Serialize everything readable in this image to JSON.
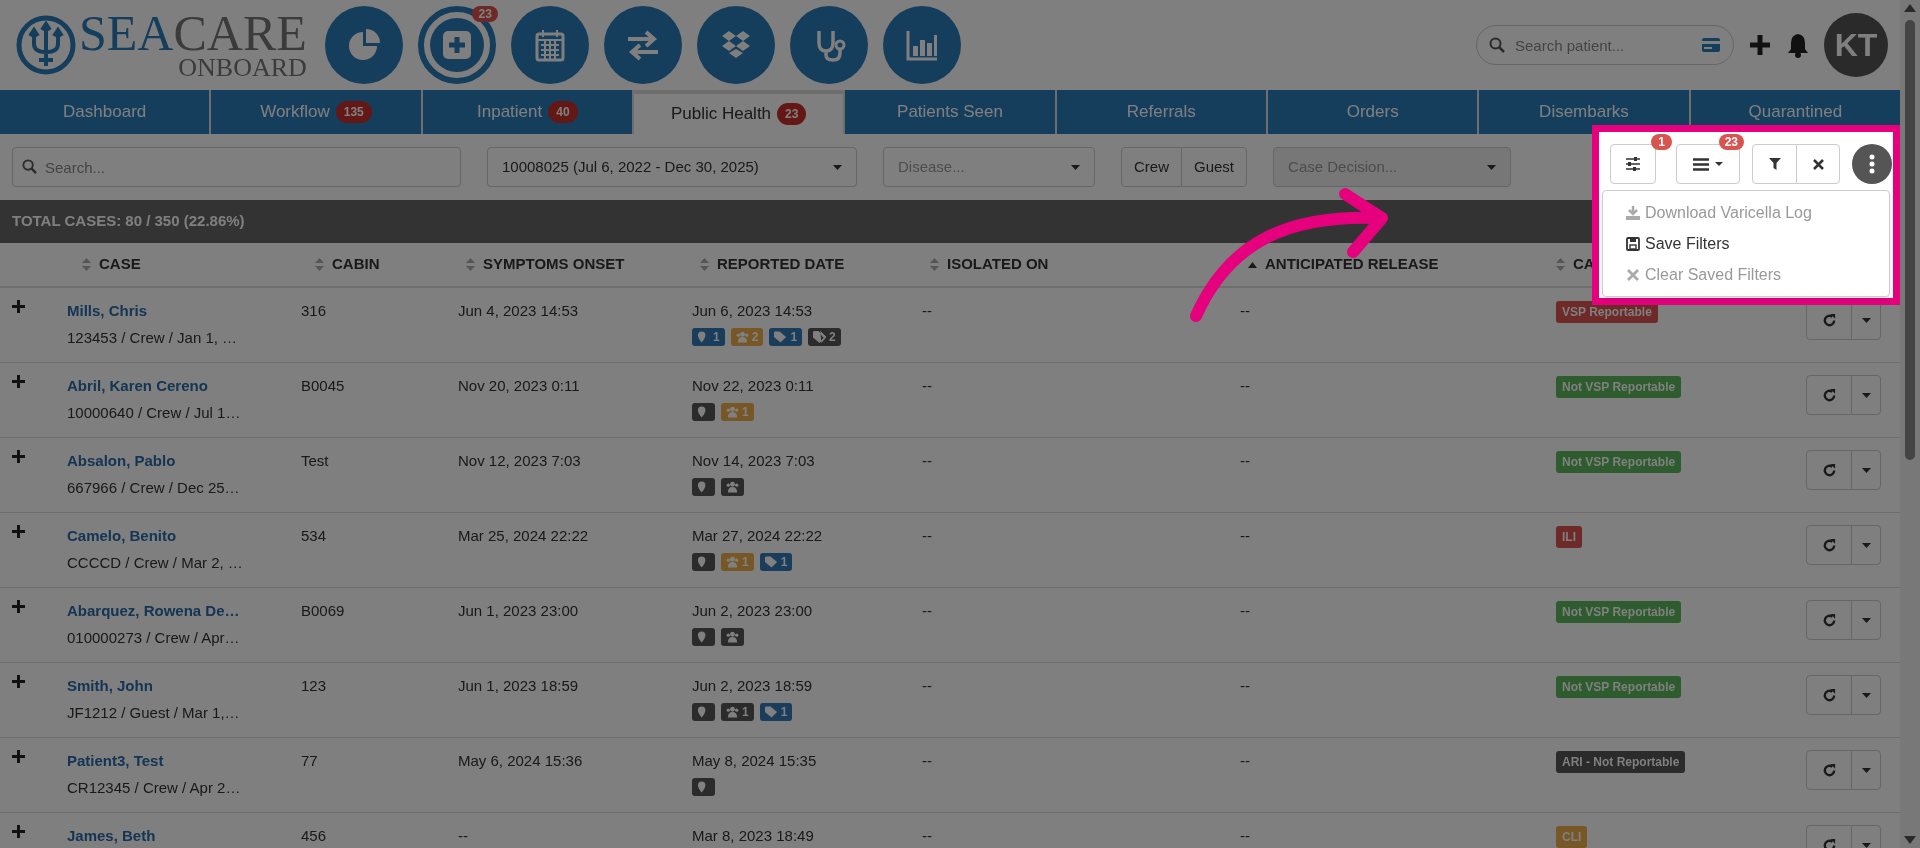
{
  "logo": {
    "brand_primary": "SEA",
    "brand_secondary": "CARE",
    "tagline": "ONBOARD"
  },
  "app_icons": [
    {
      "kind": "pie",
      "selected": false
    },
    {
      "kind": "plus",
      "selected": true,
      "badge": "23"
    },
    {
      "kind": "calendar",
      "selected": false
    },
    {
      "kind": "exchange",
      "selected": false
    },
    {
      "kind": "boxes",
      "selected": false
    },
    {
      "kind": "stethoscope",
      "selected": false
    },
    {
      "kind": "bars",
      "selected": false
    }
  ],
  "patient_search": {
    "placeholder": "Search patient..."
  },
  "user": {
    "initials": "KT"
  },
  "tabs": [
    {
      "label": "Dashboard",
      "selected": false
    },
    {
      "label": "Workflow",
      "badge": "135",
      "selected": false
    },
    {
      "label": "Inpatient",
      "badge": "40",
      "selected": false
    },
    {
      "label": "Public Health",
      "badge": "23",
      "selected": true
    },
    {
      "label": "Patients Seen",
      "selected": false
    },
    {
      "label": "Referrals",
      "selected": false
    },
    {
      "label": "Orders",
      "selected": false
    },
    {
      "label": "Disembarks",
      "selected": false
    },
    {
      "label": "Quarantined",
      "selected": false
    }
  ],
  "filters": {
    "search": {
      "placeholder": "Search..."
    },
    "voyage": {
      "value": "10008025 (Jul 6, 2022 - Dec 30, 2025)"
    },
    "disease": {
      "placeholder": "Disease..."
    },
    "population": [
      {
        "label": "Crew",
        "selected": false
      },
      {
        "label": "Guest",
        "selected": false
      }
    ],
    "case_decision": {
      "placeholder": "Case Decision..."
    }
  },
  "toolbar": {
    "settings_badge": "1",
    "columns_badge": "23"
  },
  "menu": {
    "items": [
      {
        "label": "Download Varicella Log",
        "disabled": true
      },
      {
        "label": "Save Filters",
        "disabled": false
      },
      {
        "label": "Clear Saved Filters",
        "disabled": true
      }
    ]
  },
  "summary": "TOTAL CASES: 80 / 350 (22.86%)",
  "table": {
    "columns": [
      {
        "label": "CASE",
        "sorted": false
      },
      {
        "label": "CABIN",
        "sorted": false
      },
      {
        "label": "SYMPTOMS ONSET",
        "sorted": false
      },
      {
        "label": "REPORTED DATE",
        "sorted": false
      },
      {
        "label": "ISOLATED ON",
        "sorted": false
      },
      {
        "label": "ANTICIPATED RELEASE",
        "sorted": true
      },
      {
        "label": "CA",
        "sorted": false
      }
    ],
    "rows": [
      {
        "name": "Mills, Chris",
        "details": "123453 / Crew / Jan 1, …",
        "cabin": "316",
        "onset": "Jun 4, 2023 14:53",
        "reported": "Jun 6, 2023 14:53",
        "tags": [
          {
            "kind": "pin",
            "color": "#1a3d5c",
            "count": "1"
          },
          {
            "kind": "users",
            "color": "#785727",
            "count": "2"
          },
          {
            "kind": "tag",
            "color": "#1a3d5c",
            "count": "1"
          },
          {
            "kind": "tags",
            "color": "#2b2b2b",
            "count": "2"
          }
        ],
        "isolated": "--",
        "release": "--",
        "decision": {
          "label": "VSP Reportable",
          "color": "#6d2a28"
        }
      },
      {
        "name": "Abril, Karen Cereno",
        "details": "10000640 / Crew / Jul 1…",
        "cabin": "B0045",
        "onset": "Nov 20, 2023 0:11",
        "reported": "Nov 22, 2023 0:11",
        "tags": [
          {
            "kind": "pin",
            "color": "#2b2b2b"
          },
          {
            "kind": "users",
            "color": "#785727",
            "count": "1"
          }
        ],
        "isolated": "--",
        "release": "--",
        "decision": {
          "label": "Not VSP Reportable",
          "color": "#2e5c2e"
        }
      },
      {
        "name": "Absalon, Pablo",
        "details": "667966 / Crew / Dec 25…",
        "cabin": "Test",
        "onset": "Nov 12, 2023 7:03",
        "reported": "Nov 14, 2023 7:03",
        "tags": [
          {
            "kind": "pin",
            "color": "#2b2b2b"
          },
          {
            "kind": "users",
            "color": "#2b2b2b"
          }
        ],
        "isolated": "--",
        "release": "--",
        "decision": {
          "label": "Not VSP Reportable",
          "color": "#2e5c2e"
        }
      },
      {
        "name": "Camelo, Benito",
        "details": "CCCCD / Crew / Mar 2, …",
        "cabin": "534",
        "onset": "Mar 25, 2024 22:22",
        "reported": "Mar 27, 2024 22:22",
        "tags": [
          {
            "kind": "pin",
            "color": "#2b2b2b"
          },
          {
            "kind": "users",
            "color": "#785727",
            "count": "1"
          },
          {
            "kind": "tag",
            "color": "#1a3d5c",
            "count": "1"
          }
        ],
        "isolated": "--",
        "release": "--",
        "decision": {
          "label": "ILI",
          "color": "#6d2a28"
        }
      },
      {
        "name": "Abarquez, Rowena De…",
        "details": "010000273 / Crew / Apr…",
        "cabin": "B0069",
        "onset": "Jun 1, 2023 23:00",
        "reported": "Jun 2, 2023 23:00",
        "tags": [
          {
            "kind": "pin",
            "color": "#2b2b2b"
          },
          {
            "kind": "users",
            "color": "#2b2b2b"
          }
        ],
        "isolated": "--",
        "release": "--",
        "decision": {
          "label": "Not VSP Reportable",
          "color": "#2e5c2e"
        }
      },
      {
        "name": "Smith, John",
        "details": "JF1212 / Guest / Mar 1,…",
        "cabin": "123",
        "onset": "Jun 1, 2023 18:59",
        "reported": "Jun 2, 2023 18:59",
        "tags": [
          {
            "kind": "pin",
            "color": "#2b2b2b"
          },
          {
            "kind": "users",
            "color": "#2b2b2b",
            "count": "1"
          },
          {
            "kind": "tag",
            "color": "#1a3d5c",
            "count": "1"
          }
        ],
        "isolated": "--",
        "release": "--",
        "decision": {
          "label": "Not VSP Reportable",
          "color": "#2e5c2e"
        }
      },
      {
        "name": "Patient3, Test",
        "details": "CR12345 / Crew / Apr 2…",
        "cabin": "77",
        "onset": "May 6, 2024 15:36",
        "reported": "May 8, 2024 15:35",
        "tags": [
          {
            "kind": "pin",
            "color": "#2b2b2b"
          }
        ],
        "isolated": "--",
        "release": "--",
        "decision": {
          "label": "ARI - Not Reportable",
          "color": "#2b2b2b"
        }
      },
      {
        "name": "James, Beth",
        "cabin": "456",
        "onset": "--",
        "reported": "Mar 8, 2023 18:49",
        "tags": [],
        "isolated": "--",
        "release": "--",
        "decision": {
          "label": "CLI",
          "color": "#785727"
        }
      }
    ]
  }
}
